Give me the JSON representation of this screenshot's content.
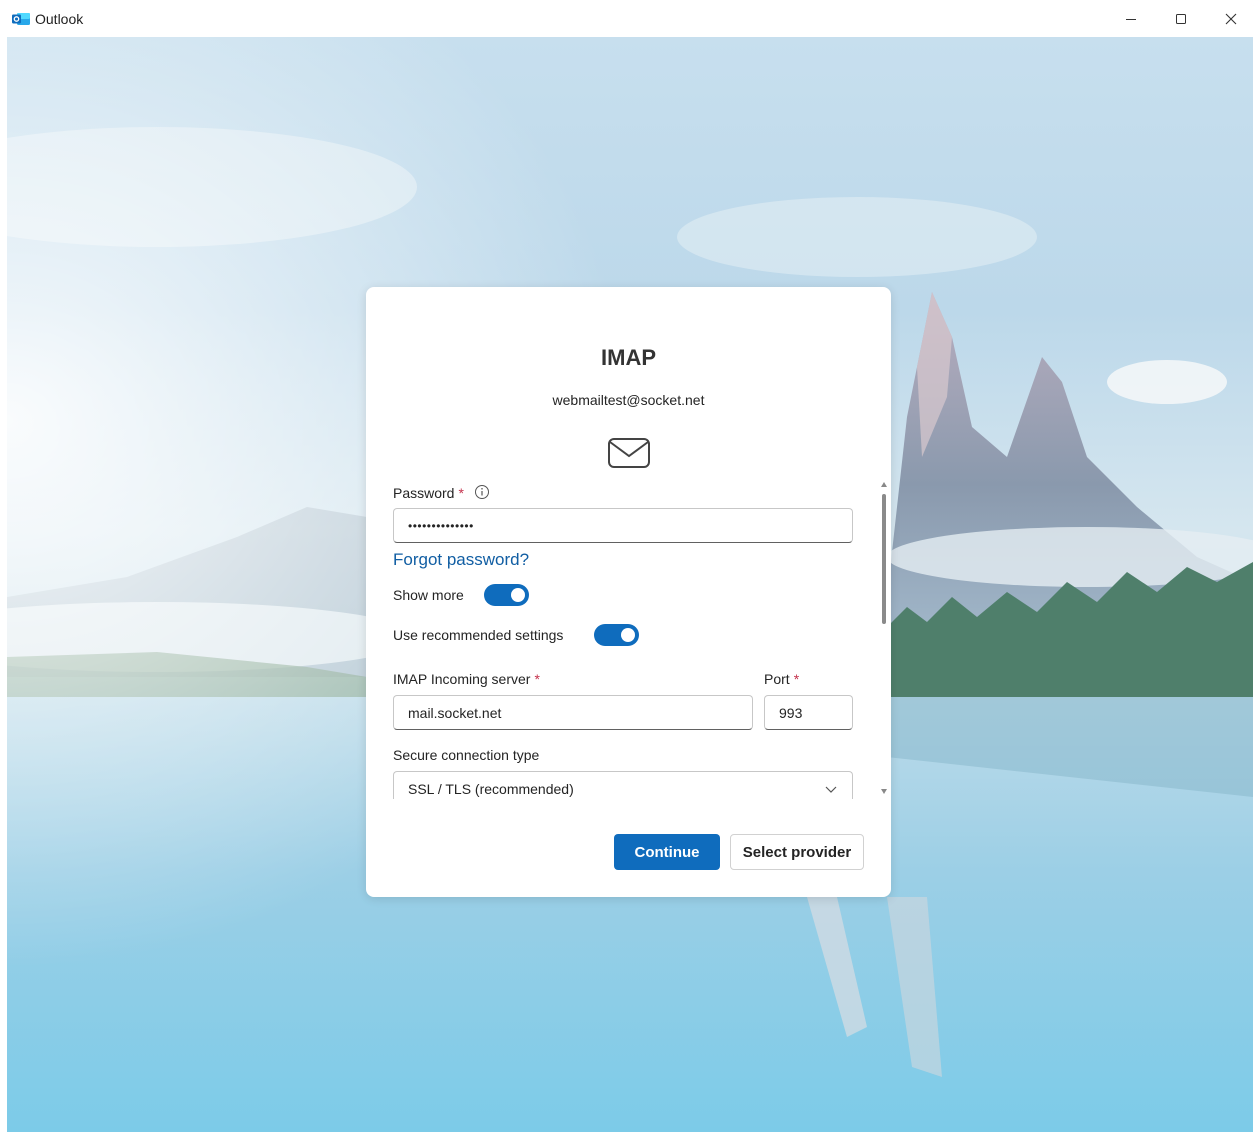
{
  "window": {
    "app_title": "Outlook",
    "icons": {
      "minimize": "minimize-icon",
      "maximize": "maximize-icon",
      "close": "close-icon"
    }
  },
  "dialog": {
    "title": "IMAP",
    "email": "webmailtest@socket.net",
    "password": {
      "label": "Password",
      "required_mark": "*",
      "value": "••••••••••••••"
    },
    "forgot_password": "Forgot password?",
    "show_more": {
      "label": "Show more",
      "on": true
    },
    "use_recommended": {
      "label": "Use recommended settings",
      "on": true
    },
    "incoming_server": {
      "label": "IMAP Incoming server",
      "required_mark": "*",
      "value": "mail.socket.net"
    },
    "port": {
      "label": "Port",
      "required_mark": "*",
      "value": "993"
    },
    "secure_connection": {
      "label": "Secure connection type",
      "value": "SSL / TLS (recommended)"
    },
    "buttons": {
      "continue": "Continue",
      "select_provider": "Select provider"
    }
  },
  "colors": {
    "accent": "#0f6cbd",
    "required": "#c4314b",
    "link": "#115ea3"
  }
}
